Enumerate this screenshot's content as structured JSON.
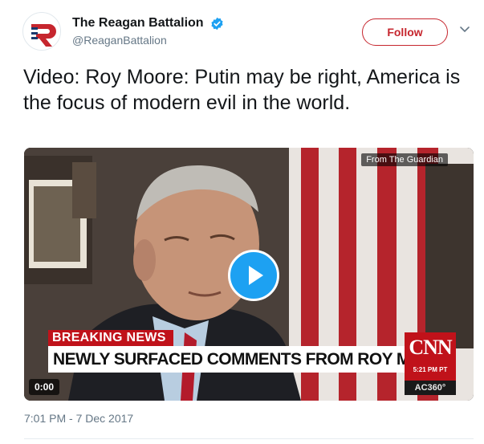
{
  "author": {
    "display_name": "The Reagan Battalion",
    "handle": "@ReaganBattalion",
    "avatar_icon": "reagan-battalion-r-logo",
    "verified_icon": "verified-badge-icon"
  },
  "actions": {
    "follow_label": "Follow",
    "menu_icon": "chevron-down-icon"
  },
  "tweet": {
    "text": "Video: Roy Moore: Putin may be right, America is the focus of modern evil in the world.",
    "timestamp": "7:01 PM - 7 Dec 2017"
  },
  "video": {
    "source_label": "From The Guardian",
    "duration": "0:00",
    "play_icon": "play-icon",
    "breaking_label": "BREAKING NEWS",
    "headline": "NEWLY SURFACED COMMENTS FROM ROY MOORE",
    "network": "CNN",
    "broadcast_time": "5:21 PM PT",
    "show": "AC360°"
  },
  "colors": {
    "accent": "#c6262e",
    "play_button": "#1da1f2",
    "cnn_red": "#c0121a",
    "secondary_text": "#657786"
  }
}
